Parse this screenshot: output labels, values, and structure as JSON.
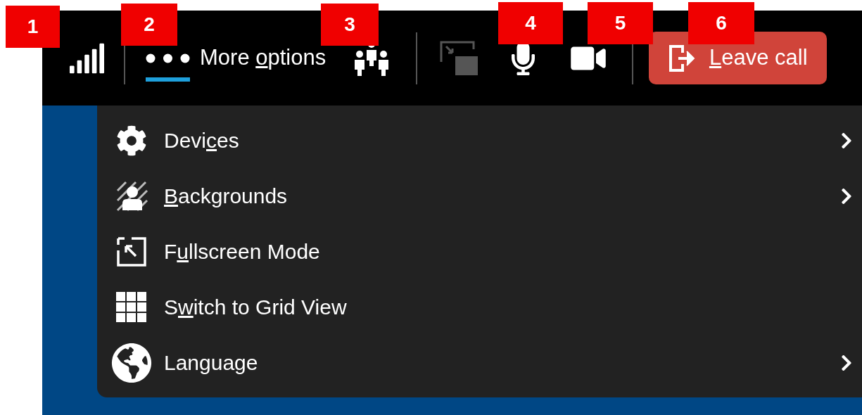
{
  "badges": [
    "1",
    "2",
    "3",
    "4",
    "5",
    "6"
  ],
  "toolbar": {
    "more_options": {
      "label": {
        "before": "More ",
        "key": "o",
        "after": "ptions"
      },
      "selected": true
    },
    "share_screen": {
      "disabled": true
    },
    "leave_button": {
      "label": {
        "key": "L",
        "after": "eave call"
      }
    }
  },
  "menu": {
    "items": [
      {
        "label": {
          "before": "Devi",
          "key": "c",
          "after": "es"
        },
        "submenu": true
      },
      {
        "label": {
          "key": "B",
          "after": "ackgrounds"
        },
        "submenu": true
      },
      {
        "label": {
          "before": "F",
          "key": "u",
          "after": "llscreen Mode"
        },
        "submenu": false
      },
      {
        "label": {
          "before": "S",
          "key": "w",
          "after": "itch to Grid View"
        },
        "submenu": false
      },
      {
        "label": {
          "after": "Language"
        },
        "submenu": true
      }
    ]
  }
}
